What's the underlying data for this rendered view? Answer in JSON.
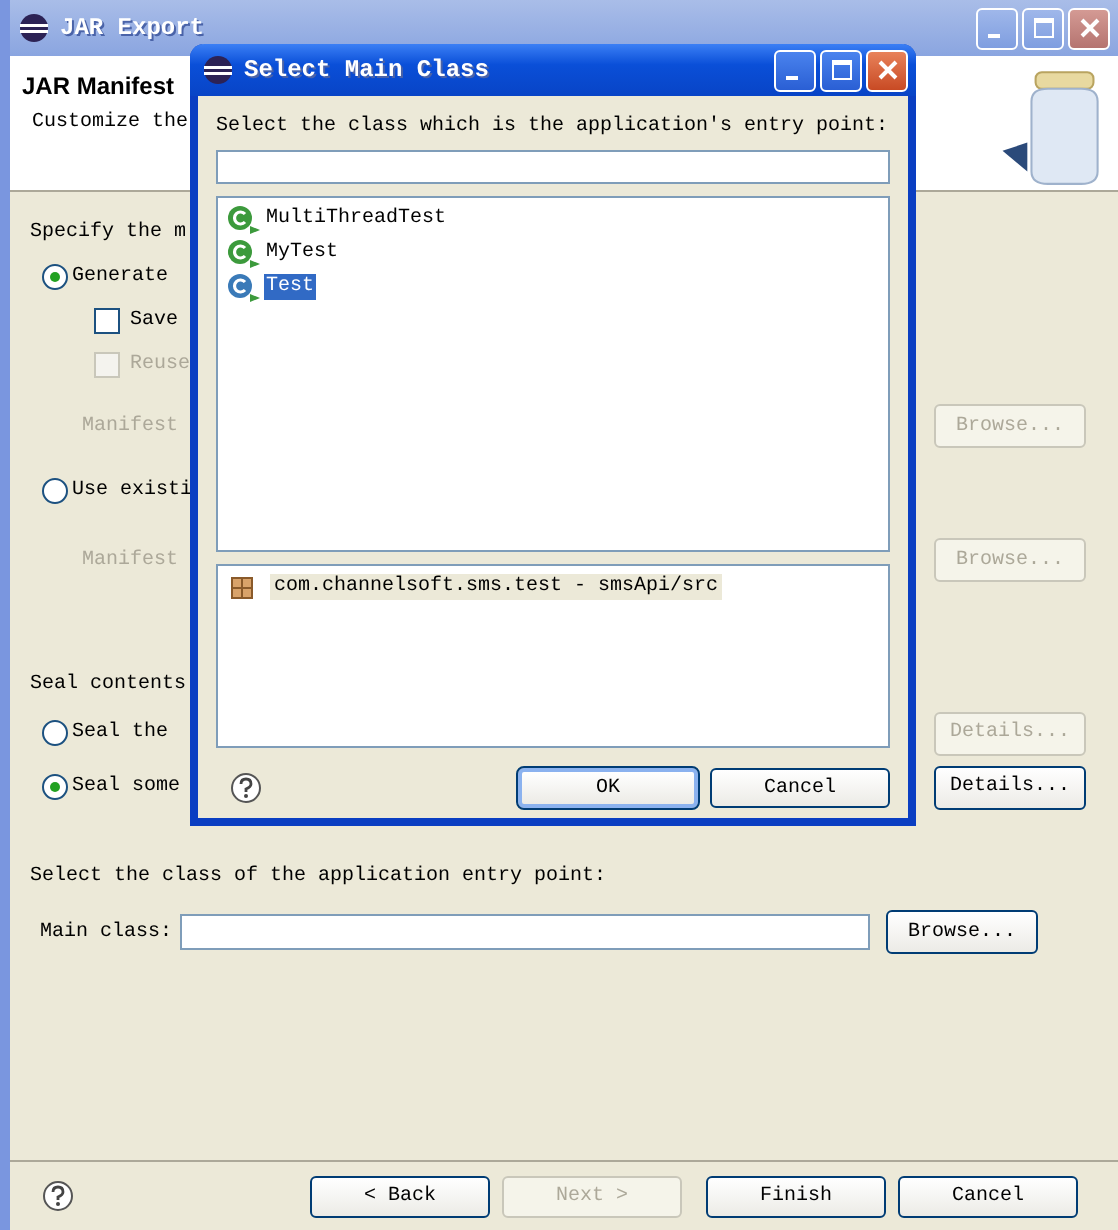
{
  "window": {
    "title": "JAR Export",
    "header_title": "JAR Manifest",
    "header_text": "Customize the"
  },
  "options": [
    {
      "kind": "label",
      "text": "Specify the m"
    },
    {
      "kind": "radio",
      "text": "Generate",
      "selected": true
    },
    {
      "kind": "checkbox",
      "text": "Save",
      "checked": false,
      "disabled": false
    },
    {
      "kind": "checkbox",
      "text": "Reuse",
      "checked": false,
      "disabled": true
    },
    {
      "kind": "field",
      "text": "Manifest",
      "disabled": true,
      "button": "Browse..."
    },
    {
      "kind": "radio",
      "text": "Use existi",
      "selected": false
    },
    {
      "kind": "field",
      "text": "Manifest",
      "disabled": true,
      "button": "Browse..."
    },
    {
      "kind": "label",
      "text": "Seal contents"
    },
    {
      "kind": "radio",
      "text": "Seal the",
      "selected": false,
      "button": "Details...",
      "button_disabled": true
    },
    {
      "kind": "radio",
      "text": "Seal some",
      "selected": true,
      "button": "Details...",
      "button_disabled": false
    }
  ],
  "entry": {
    "label": "Select the class of the application entry point:",
    "field_label": "Main class:",
    "button": "Browse..."
  },
  "footer": {
    "buttons": [
      {
        "label": "< Back",
        "disabled": false
      },
      {
        "label": "Next >",
        "disabled": true
      },
      {
        "label": "Finish",
        "disabled": false
      },
      {
        "label": "Cancel",
        "disabled": false
      }
    ]
  },
  "dialog": {
    "title": "Select Main Class",
    "prompt": "Select the class which is the application's entry point:",
    "classes": [
      {
        "name": "MultiThreadTest",
        "selected": false
      },
      {
        "name": "MyTest",
        "selected": false
      },
      {
        "name": "Test",
        "selected": true
      }
    ],
    "packages": [
      {
        "name": "com.channelsoft.sms.test - smsApi/src"
      }
    ],
    "buttons": [
      {
        "label": "OK",
        "default": true
      },
      {
        "label": "Cancel",
        "default": false
      }
    ]
  }
}
